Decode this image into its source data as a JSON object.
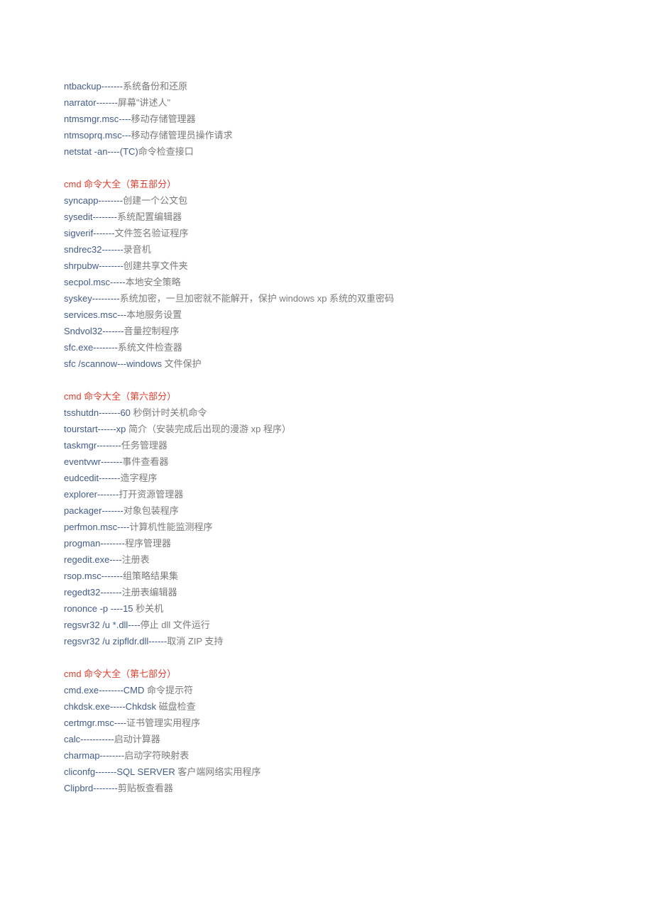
{
  "section4_tail": [
    {
      "cmd": "ntbackup-------",
      "desc": "系统备份和还原"
    },
    {
      "cmd": "narrator-------",
      "desc": "屏幕\"讲述人\""
    },
    {
      "cmd": "ntmsmgr.msc----",
      "desc": "移动存储管理器"
    },
    {
      "cmd": "ntmsoprq.msc---",
      "desc": "移动存储管理员操作请求"
    },
    {
      "cmd": "netstat -an----(TC)",
      "desc": "命令检查接口"
    }
  ],
  "heading5": "cmd 命令大全（第五部分）",
  "section5": [
    {
      "cmd": "syncapp--------",
      "desc": "创建一个公文包"
    },
    {
      "cmd": "sysedit--------",
      "desc": "系统配置编辑器"
    },
    {
      "cmd": "sigverif-------",
      "desc": "文件签名验证程序"
    },
    {
      "cmd": "sndrec32-------",
      "desc": "录音机"
    },
    {
      "cmd": "shrpubw--------",
      "desc": "创建共享文件夹"
    },
    {
      "cmd": "secpol.msc-----",
      "desc": "本地安全策略"
    },
    {
      "cmd": "syskey---------",
      "desc": "系统加密，一旦加密就不能解开，保护 windows xp 系统的双重密码"
    },
    {
      "cmd": "services.msc---",
      "desc": "本地服务设置"
    },
    {
      "cmd": "Sndvol32-------",
      "desc": "音量控制程序"
    },
    {
      "cmd": "sfc.exe--------",
      "desc": "系统文件检查器"
    },
    {
      "cmd": "sfc /scannow---windows ",
      "desc": "文件保护"
    }
  ],
  "heading6": "cmd 命令大全（第六部分）",
  "section6": [
    {
      "cmd": "tsshutdn-------60 ",
      "desc": "秒倒计时关机命令"
    },
    {
      "cmd": "tourstart------xp ",
      "desc": "简介（安装完成后出现的漫游 xp 程序）"
    },
    {
      "cmd": "taskmgr--------",
      "desc": "任务管理器"
    },
    {
      "cmd": "eventvwr-------",
      "desc": "事件查看器"
    },
    {
      "cmd": "eudcedit-------",
      "desc": "造字程序"
    },
    {
      "cmd": "explorer-------",
      "desc": "打开资源管理器"
    },
    {
      "cmd": "packager-------",
      "desc": "对象包装程序"
    },
    {
      "cmd": "perfmon.msc----",
      "desc": "计算机性能监测程序"
    },
    {
      "cmd": "progman--------",
      "desc": "程序管理器"
    },
    {
      "cmd": "regedit.exe----",
      "desc": "注册表"
    },
    {
      "cmd": "rsop.msc-------",
      "desc": "组策略结果集"
    },
    {
      "cmd": "regedt32-------",
      "desc": "注册表编辑器"
    },
    {
      "cmd": "rononce -p ----15 ",
      "desc": "秒关机"
    },
    {
      "cmd": "regsvr32 /u *.dll----",
      "desc": "停止 dll 文件运行"
    },
    {
      "cmd": "regsvr32 /u zipfldr.dll------",
      "desc": "取消 ZIP 支持"
    }
  ],
  "heading7": "cmd 命令大全（第七部分）",
  "section7": [
    {
      "cmd": "cmd.exe--------CMD ",
      "desc": "命令提示符"
    },
    {
      "cmd": "chkdsk.exe-----Chkdsk ",
      "desc": "磁盘检查"
    },
    {
      "cmd": "certmgr.msc----",
      "desc": "证书管理实用程序"
    },
    {
      "cmd": "calc-----------",
      "desc": "启动计算器"
    },
    {
      "cmd": "charmap--------",
      "desc": "启动字符映射表"
    },
    {
      "cmd": "cliconfg-------SQL SERVER  ",
      "desc": "客户端网络实用程序"
    },
    {
      "cmd": "Clipbrd--------",
      "desc": "剪贴板查看器"
    }
  ]
}
